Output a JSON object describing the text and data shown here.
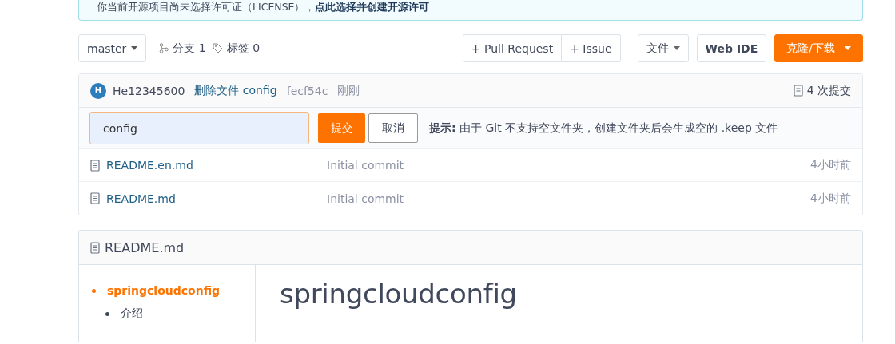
{
  "notice": {
    "text": "你当前开源项目尚未选择许可证（LICENSE），",
    "link": "点此选择并创建开源许可"
  },
  "toolbar": {
    "branch": "master",
    "branches": "分支 1",
    "tags": "标签 0",
    "buttons": [
      {
        "label": "+ Pull Request",
        "kind": "group"
      },
      {
        "label": "+ Issue",
        "kind": "group"
      },
      {
        "label": "文件",
        "kind": "dropdown"
      },
      {
        "label": "Web IDE",
        "kind": "plain"
      },
      {
        "label": "克隆/下载",
        "kind": "primary"
      }
    ]
  },
  "commit": {
    "avatar": "H",
    "author": "He12345600",
    "message": "删除文件 config",
    "hash": "fecf54c",
    "time": "刚刚",
    "count": "4 次提交"
  },
  "new_folder": {
    "value": "config",
    "submit": "提交",
    "cancel": "取消",
    "hint": "**提示:** 由于 Git 不支持空文件夹，创建文件夹后会生成空的 .keep 文件"
  },
  "files": [
    {
      "name": "README.en.md",
      "message": "Initial commit",
      "time": "4小时前"
    },
    {
      "name": "README.md",
      "message": "Initial commit",
      "time": "4小时前"
    }
  ],
  "readme": {
    "title": "README.md",
    "toc": [
      {
        "label": "springcloudconfig",
        "active": true,
        "children": [
          {
            "label": "介绍",
            "active": false
          }
        ]
      }
    ],
    "heading": "springcloudconfig"
  }
}
